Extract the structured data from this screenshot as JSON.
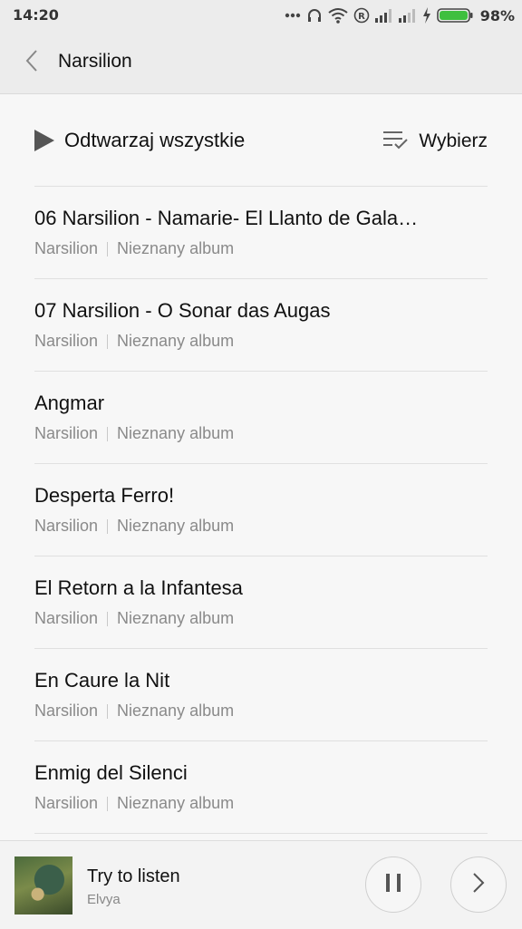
{
  "status_bar": {
    "time": "14:20",
    "battery_percent": "98%",
    "icons": [
      "more-dots-icon",
      "headphones-icon",
      "wifi-icon",
      "roaming-r-icon",
      "signal-icon",
      "signal-icon",
      "charging-icon",
      "battery-icon"
    ]
  },
  "header": {
    "title": "Narsilion",
    "back_icon": "chevron-left-icon"
  },
  "actions": {
    "play_all_label": "Odtwarzaj wszystkie",
    "select_label": "Wybierz"
  },
  "songs": [
    {
      "title": "06 Narsilion - Namarie- El Llanto de Gala…",
      "artist": "Narsilion",
      "album": "Nieznany album"
    },
    {
      "title": "07 Narsilion - O Sonar das Augas",
      "artist": "Narsilion",
      "album": "Nieznany album"
    },
    {
      "title": "Angmar",
      "artist": "Narsilion",
      "album": "Nieznany album"
    },
    {
      "title": "Desperta Ferro!",
      "artist": "Narsilion",
      "album": "Nieznany album"
    },
    {
      "title": "El Retorn a la Infantesa",
      "artist": "Narsilion",
      "album": "Nieznany album"
    },
    {
      "title": "En Caure la Nit",
      "artist": "Narsilion",
      "album": "Nieznany album"
    },
    {
      "title": "Enmig del Silenci",
      "artist": "Narsilion",
      "album": "Nieznany album"
    }
  ],
  "now_playing": {
    "title": "Try to listen",
    "artist": "Elvya",
    "controls": [
      "pause-icon",
      "next-icon"
    ]
  },
  "colors": {
    "battery_green": "#3fbf3f",
    "header_bg": "#ececec",
    "meta_text": "#8a8a8a"
  }
}
